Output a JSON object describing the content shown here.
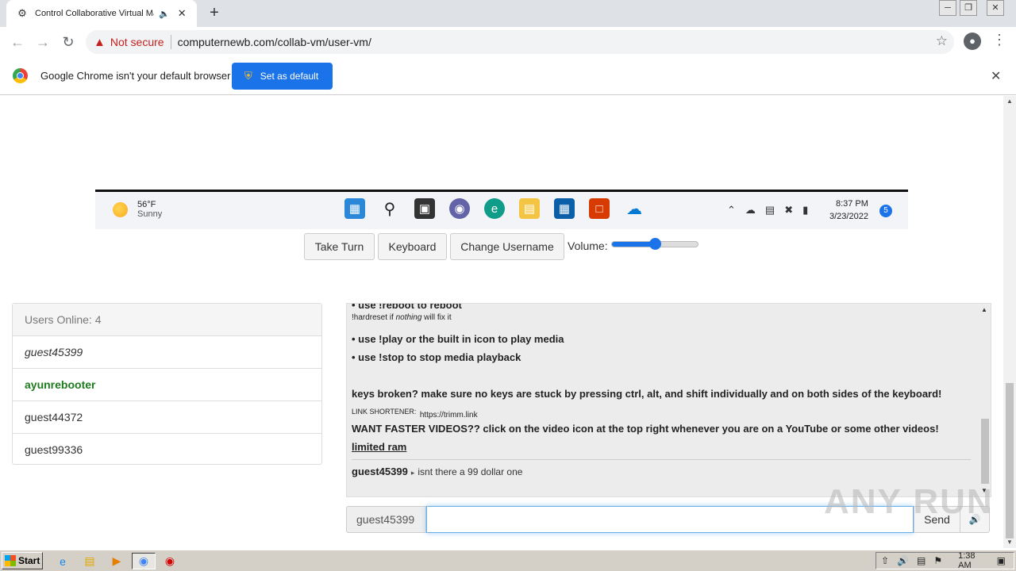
{
  "browser": {
    "tab_title": "Control Collaborative Virtual Ma",
    "security_label": "Not secure",
    "url": "computernewb.com/collab-vm/user-vm/",
    "infobar_message": "Google Chrome isn't your default browser",
    "set_default_label": "Set as default"
  },
  "vm_screen": {
    "weather_temp": "56°F",
    "weather_cond": "Sunny",
    "clock_time": "8:37 PM",
    "clock_date": "3/23/2022",
    "notification_count": "5",
    "taskbar_icons": [
      "windows-start-icon",
      "search-icon",
      "task-view-icon",
      "teams-chat-icon",
      "edge-icon",
      "file-explorer-icon",
      "store-icon",
      "office-icon",
      "onedrive-icon"
    ]
  },
  "controls": {
    "take_turn": "Take Turn",
    "keyboard": "Keyboard",
    "change_username": "Change Username",
    "volume_label": "Volume:",
    "volume_level": 0.5
  },
  "users": {
    "header": "Users Online: 4",
    "list": [
      "guest45399",
      "ayunrebooter",
      "guest44372",
      "guest99336"
    ]
  },
  "chat": {
    "line_reboot": "• use !reboot to reboot",
    "hardreset_pre": "!hardreset if ",
    "hardreset_em": "nothing",
    "hardreset_post": " will fix it",
    "line_play": "• use !play or the built in icon to play media",
    "line_stop": "• use !stop to stop media playback",
    "line_keys": "keys broken? make sure no keys are stuck by pressing ctrl, alt, and shift individually and on both sides of the keyboard!",
    "shortener_label": "LINK SHORTENER:",
    "shortener_url": "https://trimm.link",
    "line_videos": "WANT FASTER VIDEOS?? click on the video icon at the top right whenever you are on a YouTube or some other videos!",
    "line_ram": "limited ram",
    "msg_user": "guest45399",
    "msg_text": "isnt there a 99 dollar one"
  },
  "input": {
    "username": "guest45399",
    "value": "",
    "send_label": "Send"
  },
  "watermark": "ANY RUN",
  "os_taskbar": {
    "start_label": "Start",
    "clock": "1:38 AM"
  }
}
